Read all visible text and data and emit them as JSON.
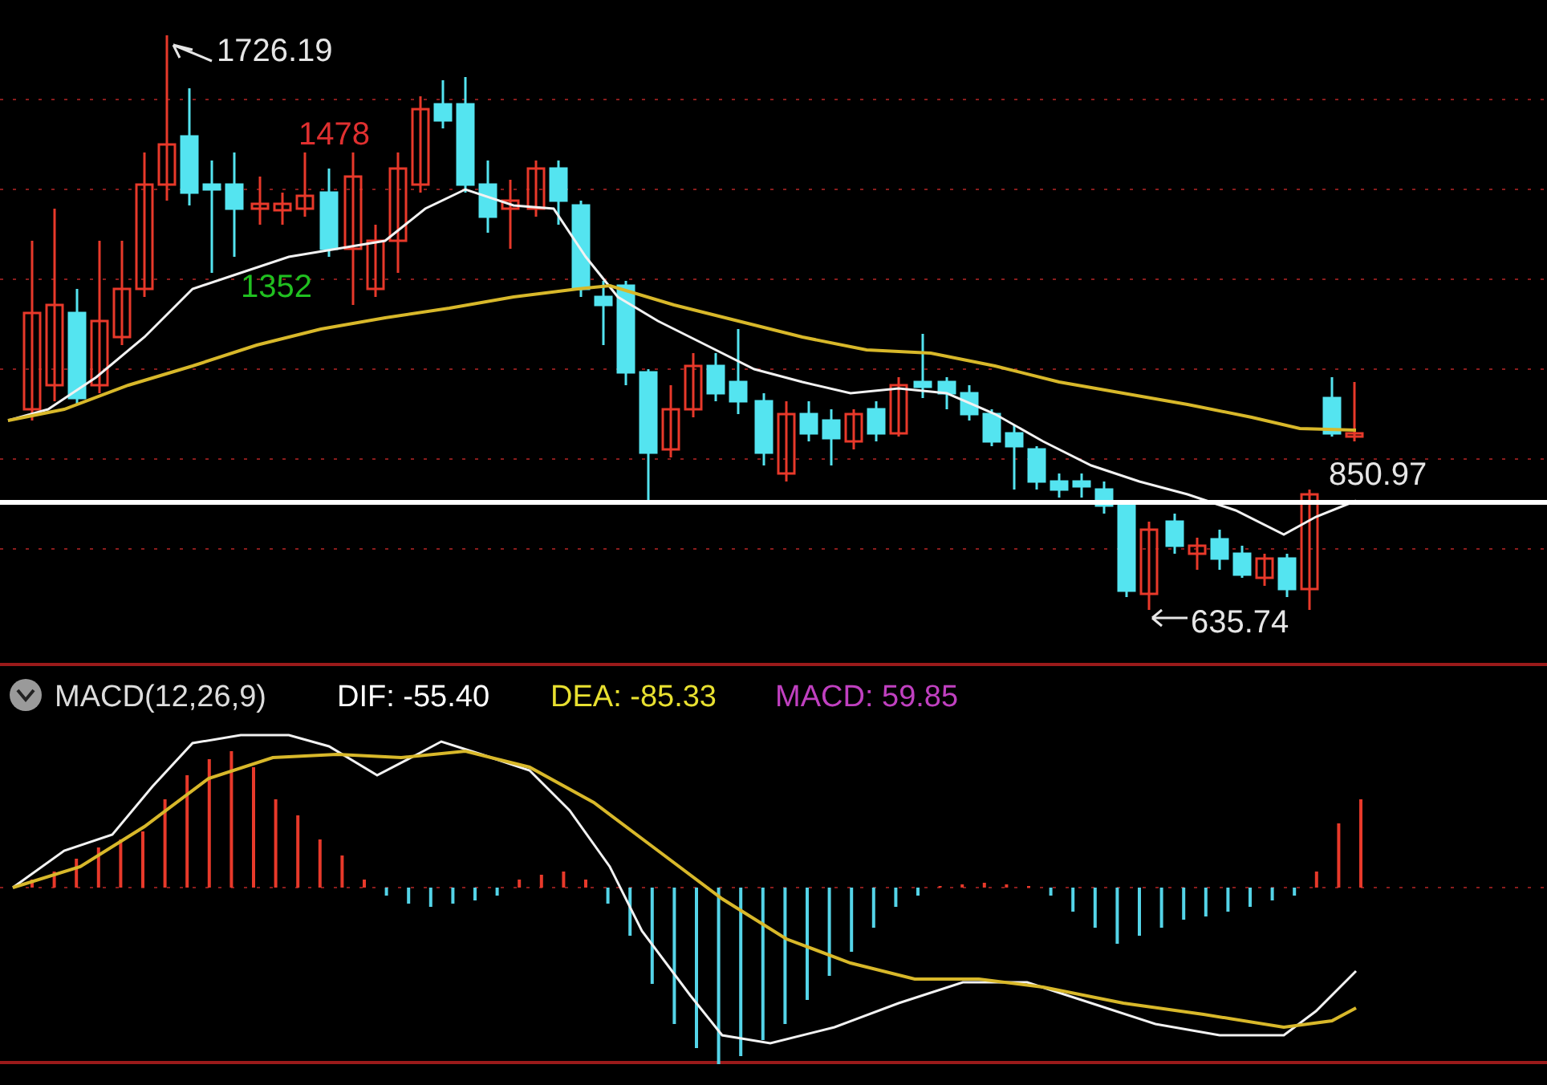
{
  "price_chart": {
    "labels": [
      {
        "kind": "high",
        "text": "1726.19"
      },
      {
        "kind": "red",
        "text": "1478"
      },
      {
        "kind": "green",
        "text": "1352"
      },
      {
        "kind": "last",
        "text": "850.97"
      },
      {
        "kind": "low",
        "text": "635.74"
      }
    ]
  },
  "macd_panel": {
    "title": "MACD(12,26,9)",
    "dif": "DIF: -55.40",
    "dea": "DEA: -85.33",
    "macd": "MACD: 59.85"
  }
}
